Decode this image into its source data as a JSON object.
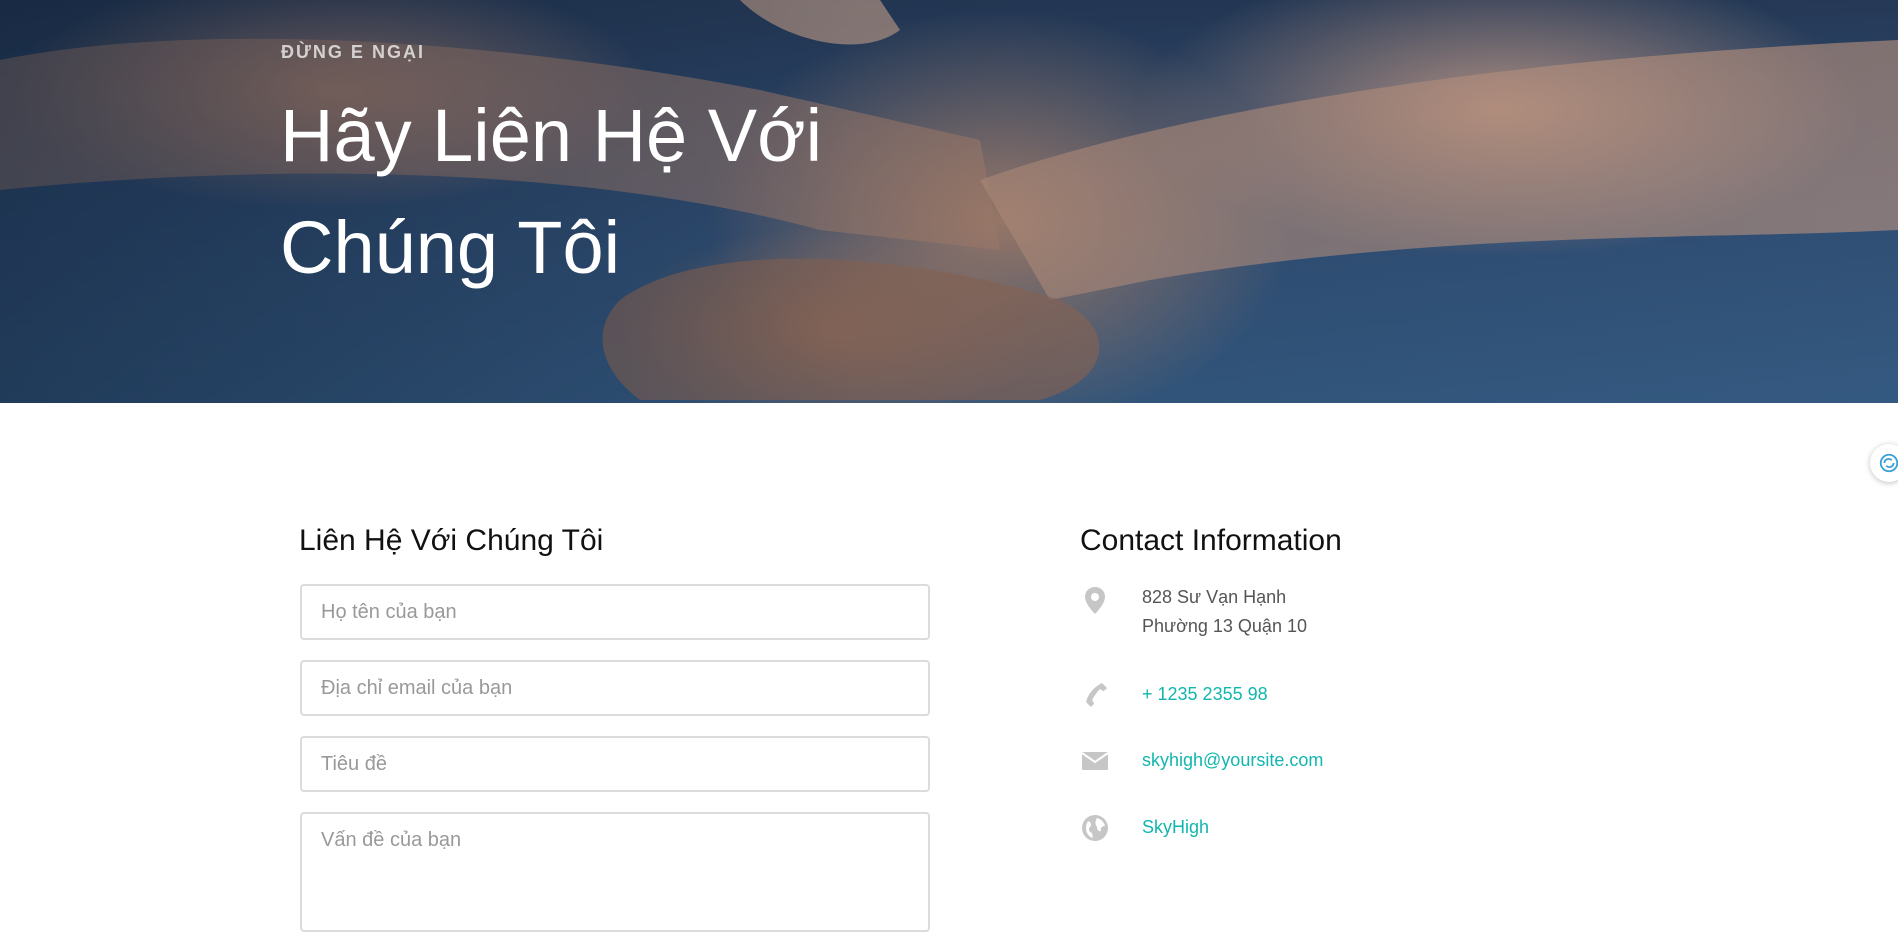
{
  "hero": {
    "kicker": "ĐỪNG E NGẠI",
    "title_line1": "Hãy Liên Hệ Với",
    "title_line2": "Chúng Tôi"
  },
  "form": {
    "title": "Liên Hệ Với Chúng Tôi",
    "name_placeholder": "Họ tên của bạn",
    "email_placeholder": "Địa chỉ email của bạn",
    "subject_placeholder": "Tiêu đề",
    "message_placeholder": "Vấn đề của bạn"
  },
  "contact": {
    "title": "Contact Information",
    "address_line1": "828 Sư Vạn Hạnh",
    "address_line2": "Phường 13 Quận 10",
    "phone": "+ 1235 2355 98",
    "email": "skyhigh@yoursite.com",
    "website": "SkyHigh"
  },
  "icons": {
    "address": "map-pin-icon",
    "phone": "phone-icon",
    "email": "envelope-icon",
    "website": "globe-icon",
    "widget": "assistant-icon"
  },
  "colors": {
    "accent": "#12b6ad",
    "icon_gray": "#c6c6c6",
    "hero_blue": "#36557d"
  }
}
